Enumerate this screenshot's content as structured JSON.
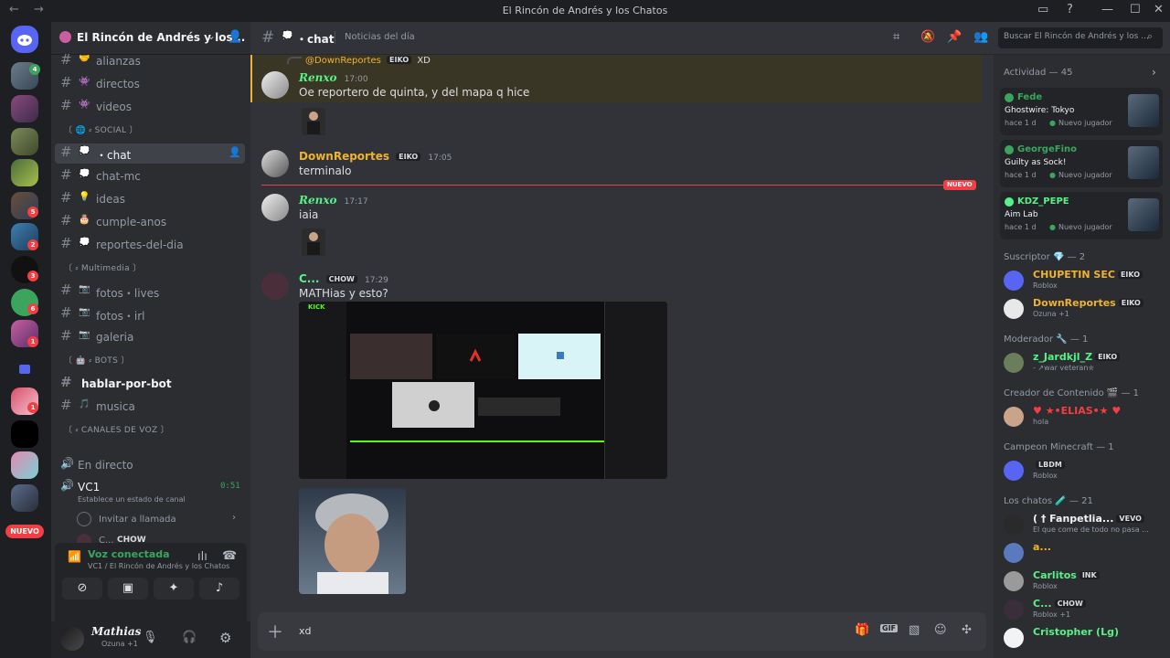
{
  "window": {
    "title": "El Rincón de Andrés y los Chatos",
    "nav": "← →",
    "controls": [
      "▭",
      "?",
      "—",
      "☐",
      "✕"
    ]
  },
  "rail": {
    "badges": [
      "4",
      "5",
      "2",
      "3",
      "6",
      "1",
      "1"
    ],
    "nuevo": "NUEVO"
  },
  "server": {
    "name": "El Rincón de Andrés y los...",
    "chevron": "⌄"
  },
  "channels": [
    {
      "icon": "🤝",
      "label": "alianzas"
    },
    {
      "icon": "👾",
      "label": "directos"
    },
    {
      "icon": "👾",
      "label": "videos"
    },
    {
      "category": "〔 🌐 ⸗ SOCIAL 〕"
    },
    {
      "icon": "💭",
      "label": "・chat",
      "selected": true
    },
    {
      "icon": "💭",
      "label": "chat-mc"
    },
    {
      "icon": "💡",
      "label": "ideas"
    },
    {
      "icon": "🎂",
      "label": "cumple-anos"
    },
    {
      "icon": "💭",
      "label": "reportes-del-dia"
    },
    {
      "category": "〔 ⸗ Multimedia 〕"
    },
    {
      "icon": "📷",
      "label": "fotos・lives"
    },
    {
      "icon": "📷",
      "label": "fotos・irl"
    },
    {
      "icon": "📷",
      "label": "galeria"
    },
    {
      "category": "〔 🤖 ⸗ BOTS 〕"
    },
    {
      "icon": "",
      "label": "hablar-por-bot",
      "bold": true
    },
    {
      "icon": "🎵",
      "label": "musica"
    },
    {
      "category": "〔 ⸗ CANALES DE VOZ 〕"
    }
  ],
  "voice_channels": {
    "en_directo": "En directo",
    "vc1": "VC1",
    "vc1_time": "0:51",
    "vc1_status": "Establece un estado de canal",
    "invite": "Invitar a llamada",
    "member": "C...",
    "member_tag": "CHOW"
  },
  "voice_panel": {
    "status": "Voz conectada",
    "location": "VC1 / El Rincón de Andrés y los Chatos"
  },
  "user": {
    "name": "Mathias",
    "status": "Ozuna +1"
  },
  "topbar": {
    "channel": "・chat",
    "topic": "Noticias del día",
    "search_placeholder": "Buscar El Rincón de Andrés y los ..."
  },
  "messages": {
    "reply_user": "@DownReportes",
    "reply_tag": "EIKO",
    "reply_text": "XD",
    "m1_user": "Renxo",
    "m1_time": "17:00",
    "m1_text": "Oe reportero de quinta, y del mapa q hice",
    "m2_user": "DownReportes",
    "m2_tag": "EIKO",
    "m2_time": "17:05",
    "m2_text": "terminalo",
    "new_label": "NUEVO",
    "m3_user": "Renxo",
    "m3_time": "17:17",
    "m3_text": "iaia",
    "m4_user": "C...",
    "m4_tag": "CHOW",
    "m4_time": "17:29",
    "m4_text": "MATHias y esto?",
    "kick_logo": "KICK"
  },
  "composer": {
    "value": "xd"
  },
  "members": {
    "activity_header": "Actividad — 45",
    "activities": [
      {
        "user": "Fede",
        "game": "Ghostwire: Tokyo",
        "meta": "hace 1 d",
        "meta2": "Nuevo jugador",
        "color": "#3ba55d"
      },
      {
        "user": "GeorgeFino",
        "game": "Guilty as Sock!",
        "meta": "hace 1 d",
        "meta2": "Nuevo jugador",
        "color": "#3ba55d"
      },
      {
        "user": "KDZ_PEPE",
        "game": "Aim Lab",
        "meta": "hace 1 d",
        "meta2": "Nuevo jugador",
        "color": "#57f287"
      }
    ],
    "sections": [
      {
        "title": "Suscriptor 💎 — 2",
        "items": [
          {
            "name": "CHUPETIN SEC",
            "tag": "EIKO",
            "sub": "Roblox",
            "color": "#f0b232"
          },
          {
            "name": "DownReportes",
            "tag": "EIKO",
            "sub": "Ozuna +1",
            "color": "#f0b232"
          }
        ]
      },
      {
        "title": "Moderador 🔧 — 1",
        "items": [
          {
            "name": "z_Jardkjl_Z",
            "tag": "EIKO",
            "sub": "- ↗war veteran✮",
            "color": "#57f287"
          }
        ]
      },
      {
        "title": "Creador de Contenido 🎬 — 1",
        "items": [
          {
            "name": "♥ ★•ELIAS•★ ♥",
            "tag": "",
            "sub": "hola",
            "color": "#f23f43"
          }
        ]
      },
      {
        "title": "Campeon Minecraft — 1",
        "items": [
          {
            "name": "",
            "tag": "LBDM",
            "sub": "Roblox",
            "color": "#f23f43"
          }
        ]
      },
      {
        "title": "Los chatos 🧪 — 21",
        "items": [
          {
            "name": "( † Fanpetlia...",
            "tag": "VEVO",
            "sub": "El que come de todo no pasa ...",
            "color": "#f2f3f5"
          },
          {
            "name": "a...",
            "tag": "",
            "sub": "",
            "color": "#f0b232"
          },
          {
            "name": "Carlitos",
            "tag": "INK",
            "sub": "Roblox",
            "color": "#57f287"
          },
          {
            "name": "C...",
            "tag": "CHOW",
            "sub": "Roblox +1",
            "color": "#57f287"
          },
          {
            "name": "Cristopher (Lg)",
            "tag": "",
            "sub": "",
            "color": "#57f287"
          }
        ]
      }
    ]
  }
}
